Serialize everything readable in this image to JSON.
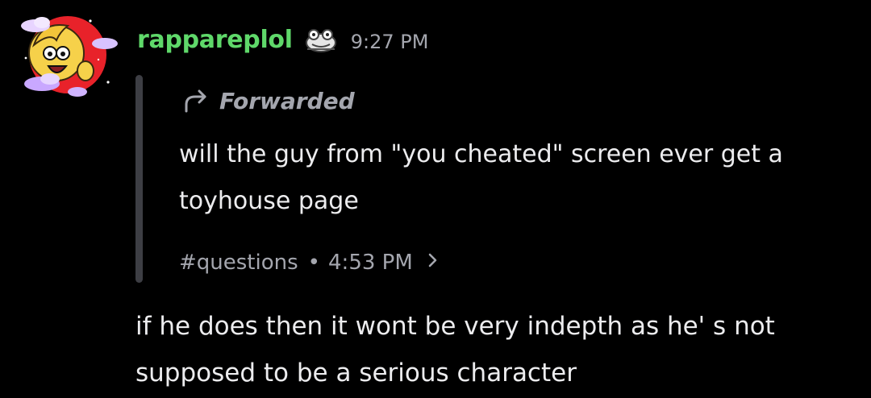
{
  "message": {
    "author": {
      "name": "rappareplol",
      "name_color": "#5fd86a",
      "avatar_icon": "cartoon-character-avatar",
      "role_icon": "frog-badge-icon"
    },
    "timestamp": "9:27 PM",
    "forward": {
      "label": "Forwarded",
      "arrow_icon": "forward-arrow-icon",
      "text": "will the guy from \"you cheated\" screen ever get a toyhouse page",
      "channel": "#questions",
      "separator": "•",
      "time": "4:53 PM",
      "chevron_icon": "chevron-right-icon"
    },
    "content": "if he does then it wont be very indepth as he' s not supposed to be a serious character"
  },
  "colors": {
    "background": "#000000",
    "text": "#ececee",
    "muted": "#a4a6ae",
    "quote_bar": "#3d3e44"
  }
}
